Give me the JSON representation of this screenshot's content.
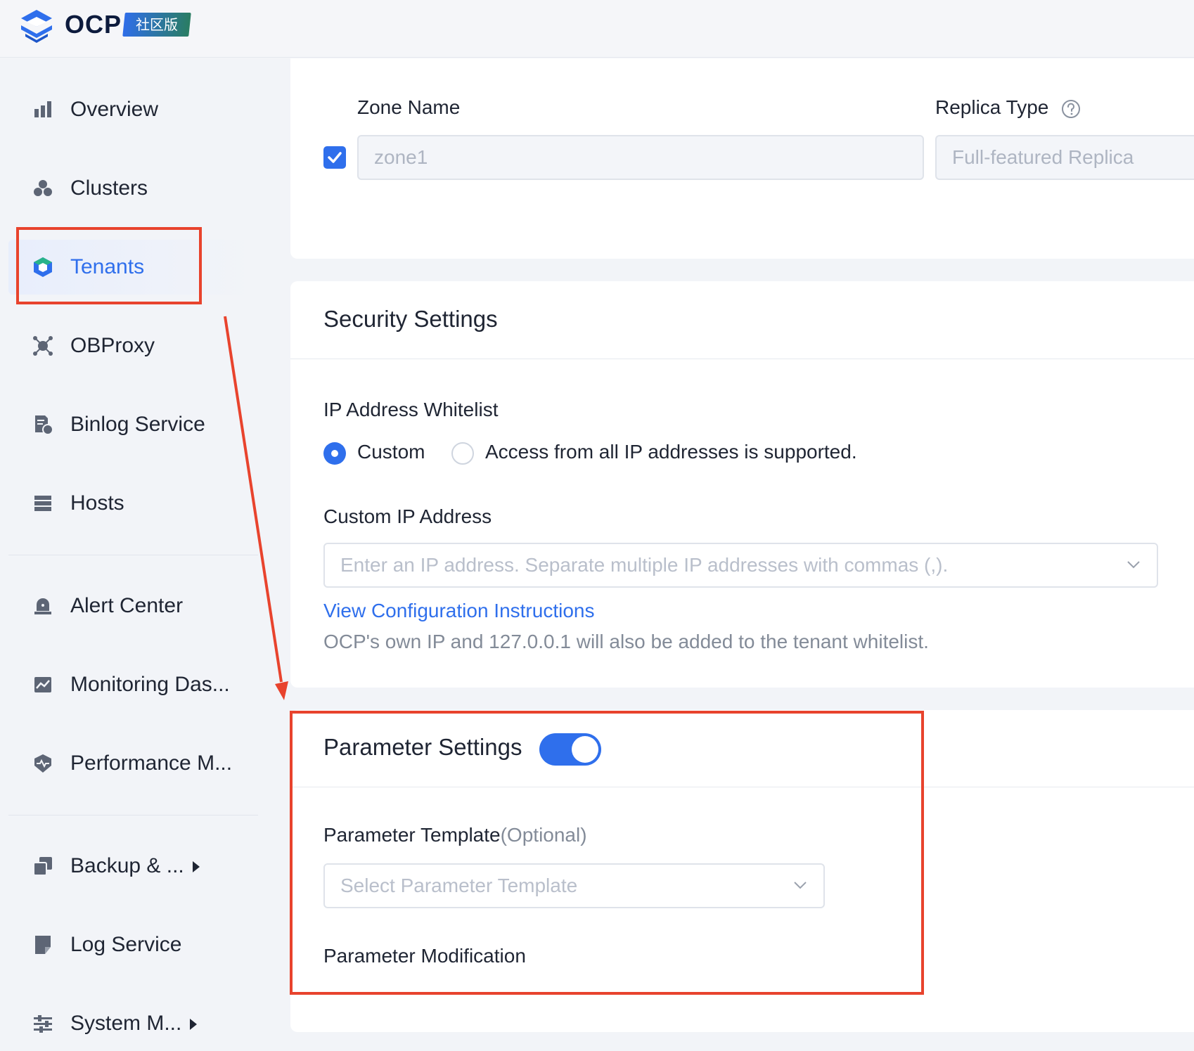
{
  "header": {
    "logo_text": "OCP",
    "edition_badge": "社区版"
  },
  "sidebar": {
    "items": [
      {
        "label": "Overview",
        "icon": "bar-chart-icon"
      },
      {
        "label": "Clusters",
        "icon": "clusters-icon"
      },
      {
        "label": "Tenants",
        "icon": "tenant-cube-icon",
        "active": true
      },
      {
        "label": "OBProxy",
        "icon": "proxy-icon"
      },
      {
        "label": "Binlog Service",
        "icon": "binlog-icon"
      },
      {
        "label": "Hosts",
        "icon": "hosts-icon"
      },
      {
        "label": "Alert Center",
        "icon": "alert-bell-icon"
      },
      {
        "label": "Monitoring Das...",
        "icon": "monitoring-icon"
      },
      {
        "label": "Performance M...",
        "icon": "performance-icon"
      },
      {
        "label": "Backup & ...",
        "icon": "backup-icon",
        "has_submenu": true
      },
      {
        "label": "Log Service",
        "icon": "log-icon"
      },
      {
        "label": "System M...",
        "icon": "settings-sliders-icon",
        "has_submenu": true
      }
    ]
  },
  "zone": {
    "zone_name_label": "Zone Name",
    "zone_name_value": "zone1",
    "zone_checked": true,
    "replica_type_label": "Replica Type",
    "replica_type_value": "Full-featured Replica"
  },
  "security": {
    "title": "Security Settings",
    "whitelist_label": "IP Address Whitelist",
    "radio_custom": "Custom",
    "radio_all": "Access from all IP addresses is supported.",
    "selected": "Custom",
    "custom_ip_label": "Custom IP Address",
    "custom_ip_placeholder": "Enter an IP address. Separate multiple IP addresses with commas (,).",
    "config_link": "View Configuration Instructions",
    "note": "OCP's own IP and 127.0.0.1 will also be added to the tenant whitelist."
  },
  "parameters": {
    "title": "Parameter Settings",
    "enabled": true,
    "template_label": "Parameter Template",
    "template_optional": "(Optional)",
    "template_placeholder": "Select Parameter Template",
    "modification_label": "Parameter Modification"
  },
  "colors": {
    "accent": "#2f6fec",
    "annotation": "#e8432d"
  }
}
